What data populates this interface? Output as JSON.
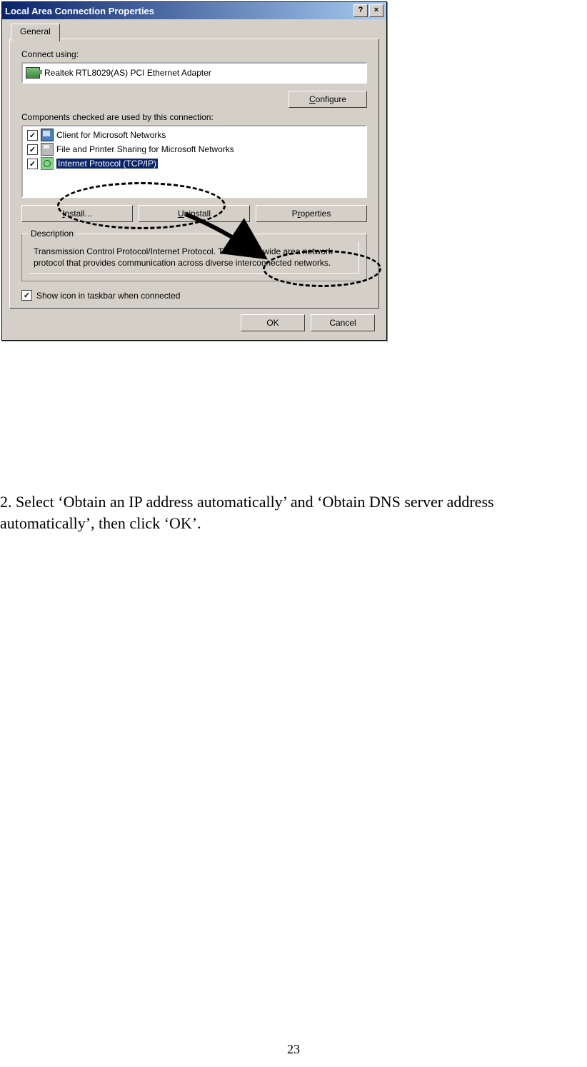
{
  "dialog": {
    "title": "Local Area Connection Properties",
    "tab": "General",
    "connect_label": "Connect using:",
    "adapter": "Realtek RTL8029(AS) PCI Ethernet Adapter",
    "configure_btn": "Configure",
    "configure_ul": "C",
    "components_label": "Components checked are used by this connection:",
    "components": [
      {
        "label": "Client for Microsoft Networks",
        "icon": "client",
        "selected": false
      },
      {
        "label": "File and Printer Sharing for Microsoft Networks",
        "icon": "printer",
        "selected": false
      },
      {
        "label": "Internet Protocol (TCP/IP)",
        "icon": "net",
        "selected": true
      }
    ],
    "install_btn": "Install...",
    "install_ul": "I",
    "uninstall_btn": "Uninstall",
    "uninstall_ul": "U",
    "properties_btn": "Properties",
    "properties_ul": "r",
    "description_title": "Description",
    "description_text": "Transmission Control Protocol/Internet Protocol. The default wide area network protocol that provides communication across diverse interconnected networks.",
    "show_icon_label_pre": "Sho",
    "show_icon_ul": "w",
    "show_icon_label_post": " icon in taskbar when connected",
    "ok_btn": "OK",
    "cancel_btn": "Cancel"
  },
  "instruction": "2. Select ‘Obtain an IP address automatically’ and ‘Obtain DNS server address automatically’, then click ‘OK’.",
  "page_number": "23"
}
